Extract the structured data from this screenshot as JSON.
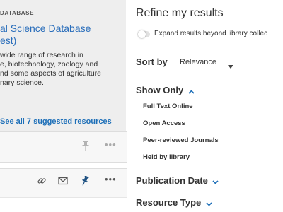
{
  "suggested_resource": {
    "tag": "DATABASE",
    "title_line1": "al Science Database",
    "title_line2": "est)",
    "description_lines": [
      "wide range of research in",
      "e, biotechnology, zoology and",
      "nd some aspects of agriculture",
      "nary science."
    ],
    "see_all_label": "See all 7 suggested resources"
  },
  "refine": {
    "title": "Refine my results",
    "expand_label": "Expand results beyond library collec",
    "sort_by_label": "Sort by",
    "sort_value": "Relevance",
    "show_only_label": "Show Only",
    "filters": [
      "Full Text Online",
      "Open Access",
      "Peer-reviewed Journals",
      "Held by library"
    ],
    "publication_date_label": "Publication Date",
    "resource_type_label": "Resource Type"
  },
  "colors": {
    "link": "#2a6ebb",
    "accent": "#1d6fb8",
    "card_bg": "#eeeeee"
  }
}
